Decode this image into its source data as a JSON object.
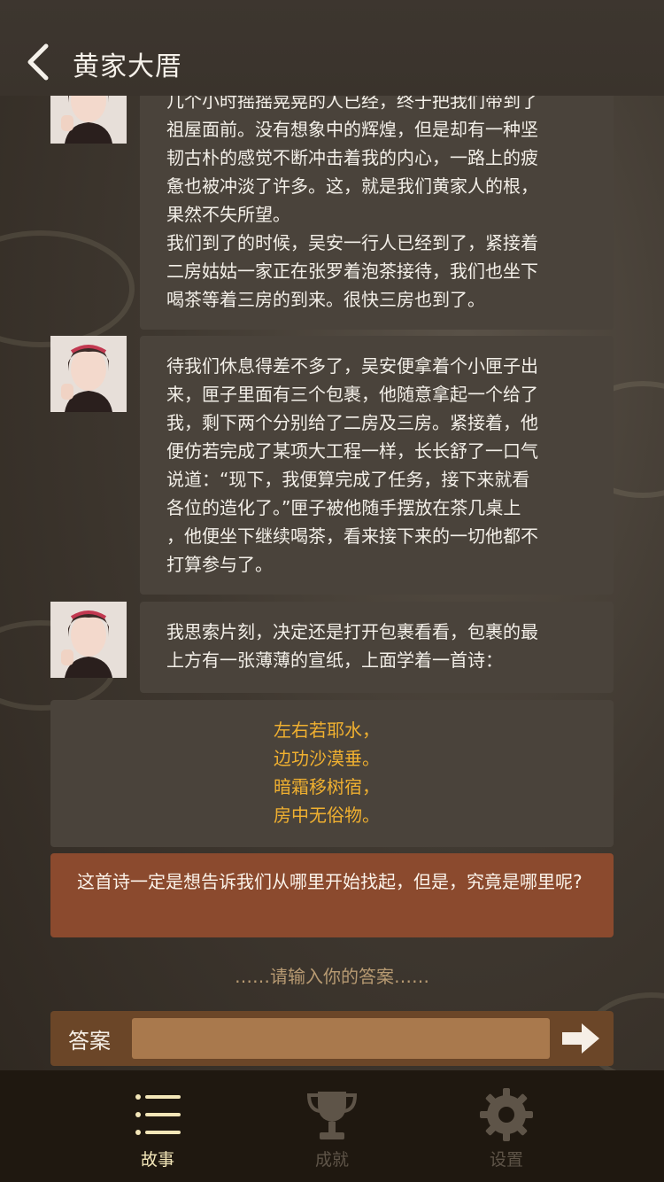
{
  "header": {
    "title": "黄家大厝"
  },
  "messages": [
    {
      "lines": [
        "几个小时摇摇晃晃的人已经，终于把我们带到了",
        "祖屋面前。没有想象中的辉煌，但是却有一种坚",
        "韧古朴的感觉不断冲击着我的内心，一路上的疲",
        "惫也被冲淡了许多。这，就是我们黄家人的根，",
        "果然不失所望。",
        "我们到了的时候，吴安一行人已经到了，紧接着",
        "二房姑姑一家正在张罗着泡茶接待，我们也坐下",
        "喝茶等着三房的到来。很快三房也到了。"
      ]
    },
    {
      "lines": [
        "待我们休息得差不多了，吴安便拿着个小匣子出",
        "来，匣子里面有三个包裹，他随意拿起一个给了",
        "我，剩下两个分别给了二房及三房。紧接着，他",
        "便仿若完成了某项大工程一样，长长舒了一口气",
        "说道：“现下，我便算完成了任务，接下来就看",
        "各位的造化了。”匣子被他随手摆放在茶几桌上",
        "，他便坐下继续喝茶，看来接下来的一切他都不",
        "打算参与了。"
      ]
    },
    {
      "lines": [
        "我思索片刻，决定还是打开包裹看看，包裹的最",
        "上方有一张薄薄的宣纸，上面学着一首诗："
      ]
    }
  ],
  "poem": [
    "左右若耶水，",
    "边功沙漠垂。",
    "暗霜移树宿，",
    "房中无俗物。"
  ],
  "hint": "这首诗一定是想告诉我们从哪里开始找起，但是，究竟是哪里呢?",
  "prompt": "……请输入你的答案……",
  "answer": {
    "label": "答案",
    "value": "",
    "placeholder": ""
  },
  "tabs": [
    {
      "label": "故事",
      "icon": "list-icon",
      "active": true
    },
    {
      "label": "成就",
      "icon": "trophy-icon",
      "active": false
    },
    {
      "label": "设置",
      "icon": "gear-icon",
      "active": false
    }
  ],
  "colors": {
    "bubble": "#4a433b",
    "hint": "#8b4a2e",
    "poem_text": "#f0b030",
    "answer_bar": "#6b4628",
    "input": "#a9794d"
  }
}
